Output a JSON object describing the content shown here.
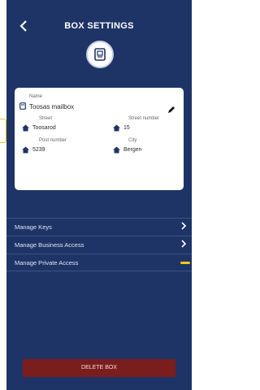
{
  "header": {
    "title": "BOX SETTINGS",
    "back_icon": "chevron-left-icon"
  },
  "card": {
    "name_label": "Name",
    "name_value": "Toosas mailbox",
    "street_label": "Street",
    "street_value": "Toosarod",
    "street_number_label": "Street number",
    "street_number_value": "15",
    "post_number_label": "Post number",
    "post_number_value": "5239",
    "city_label": "City",
    "city_value": "Bergen"
  },
  "menu": [
    {
      "label": "Manage Keys"
    },
    {
      "label": "Manage Business Access"
    },
    {
      "label": "Manage Private Access"
    }
  ],
  "delete_label": "DELETE BOX",
  "colors": {
    "background": "#1f3466",
    "card": "#ffffff",
    "delete": "#7a1d1d",
    "accent": "#f5c518"
  }
}
